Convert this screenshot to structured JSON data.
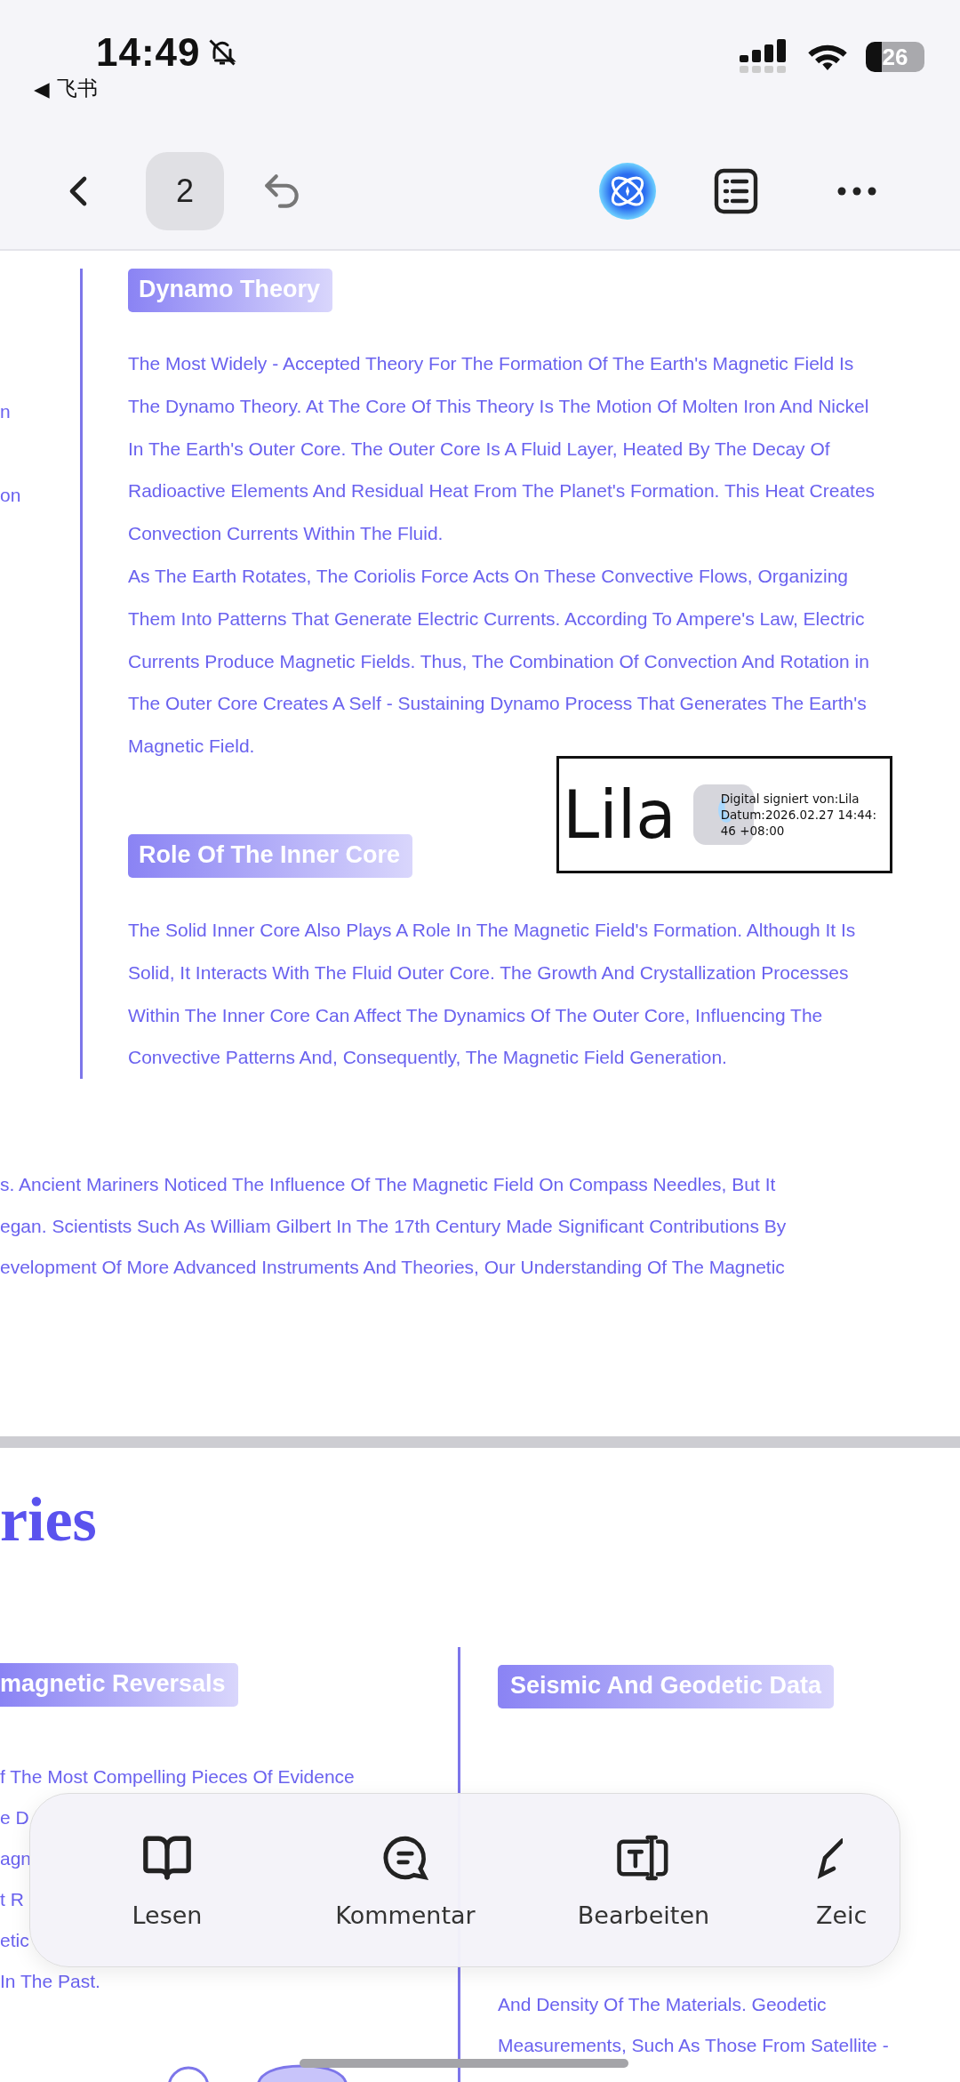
{
  "status_bar": {
    "time": "14:49",
    "back_arrow": "◀",
    "back_app": "飞书",
    "battery": "26"
  },
  "nav": {
    "page": "2"
  },
  "page_1": {
    "left_fragments": [
      "n",
      "on"
    ],
    "sections": [
      {
        "heading": "Dynamo Theory",
        "paragraphs": [
          [
            "The Most Widely - Accepted Theory For The Formation Of The Earth's Magnetic Field Is",
            "The Dynamo Theory. At The Core Of This Theory Is The Motion Of Molten Iron And Nickel",
            "In The Earth's Outer Core. The Outer Core Is A Fluid Layer, Heated By The Decay Of",
            "Radioactive Elements And Residual Heat From The Planet's Formation. This Heat Creates",
            "Convection Currents Within The Fluid."
          ],
          [
            "As The Earth Rotates, The Coriolis Force Acts On These Convective Flows, Organizing",
            "Them Into Patterns That Generate Electric Currents. According To Ampere's Law, Electric",
            "Currents Produce Magnetic Fields. Thus, The Combination Of Convection And Rotation in",
            "The Outer Core Creates A Self - Sustaining Dynamo Process That Generates The Earth's",
            "Magnetic Field."
          ]
        ]
      },
      {
        "heading": "Role Of The Inner Core",
        "paragraphs": [
          [
            "The Solid Inner Core Also Plays A Role In The Magnetic Field's Formation. Although It Is",
            "Solid, It Interacts With The Fluid Outer Core. The Growth And Crystallization Processes",
            "Within The Inner Core Can Affect The Dynamics Of The Outer Core, Influencing The",
            "Convective Patterns And, Consequently, The Magnetic Field Generation."
          ]
        ]
      }
    ],
    "signature": {
      "name": "Lila",
      "lines": [
        "Digital signiert von:Lila",
        "Datum:2026.02.27 14:44:",
        "46 +08:00"
      ]
    },
    "trailing_lines": [
      "s. Ancient Mariners Noticed The Influence Of The Magnetic Field On Compass Needles, But It",
      "egan. Scientists Such As William Gilbert In The 17th Century Made Significant Contributions By",
      "evelopment Of More Advanced Instruments And Theories, Our Understanding Of The Magnetic"
    ]
  },
  "page_2": {
    "title": "ries",
    "columns": [
      {
        "heading": "magnetic Reversals",
        "lines": [
          "f The Most Compelling Pieces Of Evidence",
          "e D",
          "agn",
          "t R",
          "etic",
          "In The Past."
        ]
      },
      {
        "heading": "Seismic And Geodetic Data",
        "lines": [
          "And Density Of The Materials. Geodetic",
          "Measurements, Such As Those From Satellite -"
        ]
      }
    ]
  },
  "bottom_toolbar": {
    "items": [
      {
        "kind": "read",
        "label": "Lesen"
      },
      {
        "kind": "comment",
        "label": "Kommentar"
      },
      {
        "kind": "edit",
        "label": "Bearbeiten"
      },
      {
        "kind": "draw",
        "label": "Zeic"
      }
    ]
  }
}
